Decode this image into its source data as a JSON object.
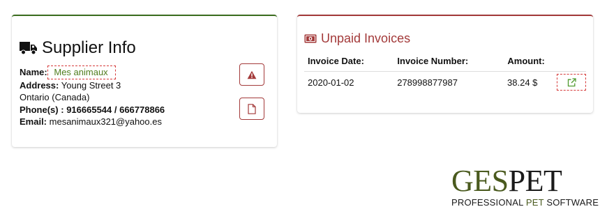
{
  "supplier": {
    "title": "Supplier Info",
    "name_label": "Name:",
    "name_value": "Mes animaux",
    "address_label": "Address:",
    "address_line1": "Young Street 3",
    "address_line2": "Ontario (Canada)",
    "phone_label": "Phone(s) :",
    "phone_value": "916665544 / 666778866",
    "email_label": "Email:",
    "email_value": "mesanimaux321@yahoo.es"
  },
  "invoices": {
    "title": "Unpaid Invoices",
    "columns": [
      "Invoice Date:",
      "Invoice Number:",
      "Amount:"
    ],
    "rows": [
      {
        "date": "2020-01-02",
        "number": "278998877987",
        "amount": "38.24 $"
      }
    ]
  },
  "logo": {
    "main_a": "GES",
    "main_b": "PET",
    "tag_a": "PROFESSIONAL ",
    "tag_b": "PET",
    "tag_c": " SOFTWARE"
  },
  "colors": {
    "supplier_accent": "#3c6e1f",
    "invoice_accent": "#a33a3a",
    "highlight_dash": "#d63a3a",
    "name_text": "#4f7d1e"
  }
}
